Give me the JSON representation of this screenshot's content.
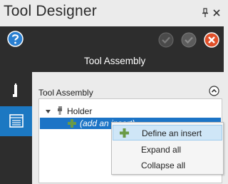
{
  "window": {
    "title": "Tool Designer"
  },
  "header": {
    "title": "Tool Assembly"
  },
  "panel": {
    "section_title": "Tool Assembly",
    "tree": {
      "root_label": "Holder",
      "child_label": "(add an insert)"
    }
  },
  "context_menu": {
    "items": [
      {
        "label": "Define an insert",
        "icon": "plus-icon"
      },
      {
        "label": "Expand all"
      },
      {
        "label": "Collapse all"
      }
    ]
  },
  "colors": {
    "dark_band": "#2d2d2d",
    "accent_blue": "#1c78c2",
    "selection": "#1c74c6",
    "success_green": "#6a9a46",
    "cancel_red": "#e0502a",
    "menu_highlight": "#cfe6f7"
  }
}
